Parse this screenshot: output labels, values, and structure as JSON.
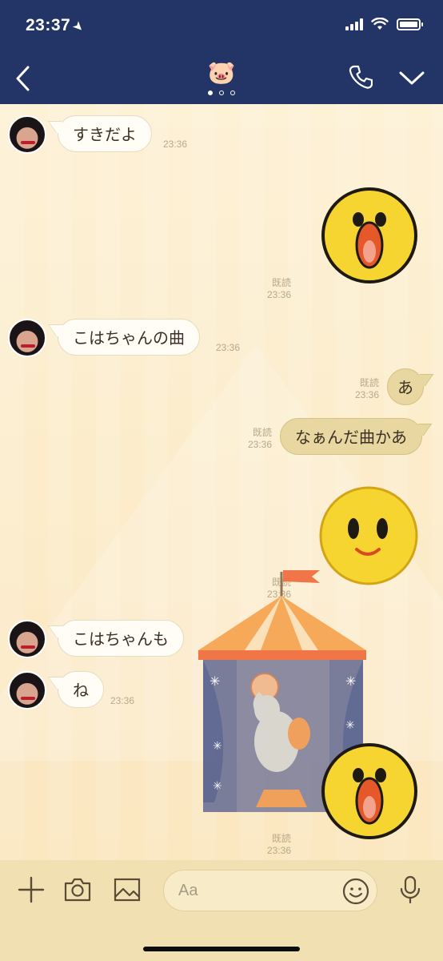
{
  "status_bar": {
    "time": "23:37",
    "location_arrow": "location-arrow-icon",
    "signal": "signal-bars-icon",
    "wifi": "wifi-icon",
    "battery": "battery-icon",
    "battery_level": 1.0
  },
  "header": {
    "title_emoji": "🐷",
    "back_icon": "chevron-left-icon",
    "call_icon": "phone-icon",
    "menu_icon": "chevron-down-icon",
    "page_dots_total": 3,
    "page_dots_active": 1
  },
  "messages": [
    {
      "direction": "in",
      "type": "text",
      "text": "すきだよ",
      "time": "23:36"
    },
    {
      "direction": "out",
      "type": "sticker",
      "sticker": "sally-surprised-sticker",
      "read": "既読",
      "time": "23:36"
    },
    {
      "direction": "in",
      "type": "text",
      "text": "こはちゃんの曲",
      "time": "23:36"
    },
    {
      "direction": "out",
      "type": "text",
      "text": "あ",
      "read": "既読",
      "time": "23:36"
    },
    {
      "direction": "out",
      "type": "text",
      "text": "なぁんだ曲かあ",
      "read": "既読",
      "time": "23:36"
    },
    {
      "direction": "out",
      "type": "sticker",
      "sticker": "sally-smile-sticker",
      "read": "既読",
      "time": "23:36"
    },
    {
      "direction": "in",
      "type": "text",
      "text": "こはちゃんも",
      "time": ""
    },
    {
      "direction": "in",
      "type": "text",
      "text": "ね",
      "time": "23:36"
    },
    {
      "direction": "out",
      "type": "sticker",
      "sticker": "sally-surprised-sticker",
      "read": "既読",
      "time": "23:36"
    }
  ],
  "overlay": {
    "name": "circus-tent-elephant-illustration"
  },
  "input_bar": {
    "add_icon": "plus-icon",
    "camera_icon": "camera-icon",
    "image_icon": "image-icon",
    "placeholder": "Aa",
    "emoji_icon": "smiley-icon",
    "mic_icon": "microphone-icon"
  },
  "colors": {
    "header_bg": "#233566",
    "chat_bg": "#fdf0d4",
    "incoming_bubble": "#fffdf5",
    "outgoing_bubble": "#e8d7a0",
    "input_bar_bg": "#f1e1b2"
  }
}
